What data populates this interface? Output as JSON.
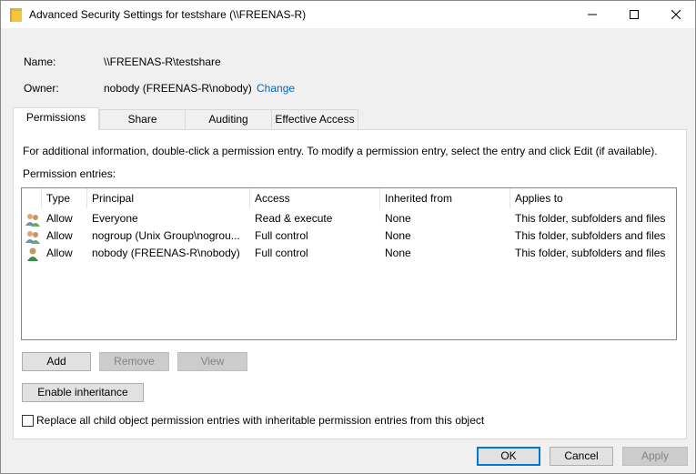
{
  "window": {
    "title": "Advanced Security Settings for testshare (\\\\FREENAS-R)"
  },
  "info": {
    "name_label": "Name:",
    "name_value": "\\\\FREENAS-R\\testshare",
    "owner_label": "Owner:",
    "owner_value": "nobody (FREENAS-R\\nobody)",
    "change_link": "Change"
  },
  "tabs": [
    {
      "label": "Permissions",
      "active": true
    },
    {
      "label": "Share",
      "active": false
    },
    {
      "label": "Auditing",
      "active": false
    },
    {
      "label": "Effective Access",
      "active": false
    }
  ],
  "permissions": {
    "info_text": "For additional information, double-click a permission entry. To modify a permission entry, select the entry and click Edit (if available).",
    "entries_label": "Permission entries:",
    "columns": [
      "Type",
      "Principal",
      "Access",
      "Inherited from",
      "Applies to"
    ],
    "rows": [
      {
        "icon": "group-icon",
        "type": "Allow",
        "principal": "Everyone",
        "access": "Read & execute",
        "inherited": "None",
        "applies": "This folder, subfolders and files"
      },
      {
        "icon": "group-icon",
        "type": "Allow",
        "principal": "nogroup (Unix Group\\nogrou...",
        "access": "Full control",
        "inherited": "None",
        "applies": "This folder, subfolders and files"
      },
      {
        "icon": "user-icon",
        "type": "Allow",
        "principal": "nobody (FREENAS-R\\nobody)",
        "access": "Full control",
        "inherited": "None",
        "applies": "This folder, subfolders and files"
      }
    ],
    "add_label": "Add",
    "remove_label": "Remove",
    "view_label": "View",
    "enable_inheritance_label": "Enable inheritance",
    "replace_checkbox_label": "Replace all child object permission entries with inheritable permission entries from this object"
  },
  "footer": {
    "ok_label": "OK",
    "cancel_label": "Cancel",
    "apply_label": "Apply"
  },
  "colors": {
    "link": "#0066cc",
    "default_button_border": "#0078d7"
  }
}
